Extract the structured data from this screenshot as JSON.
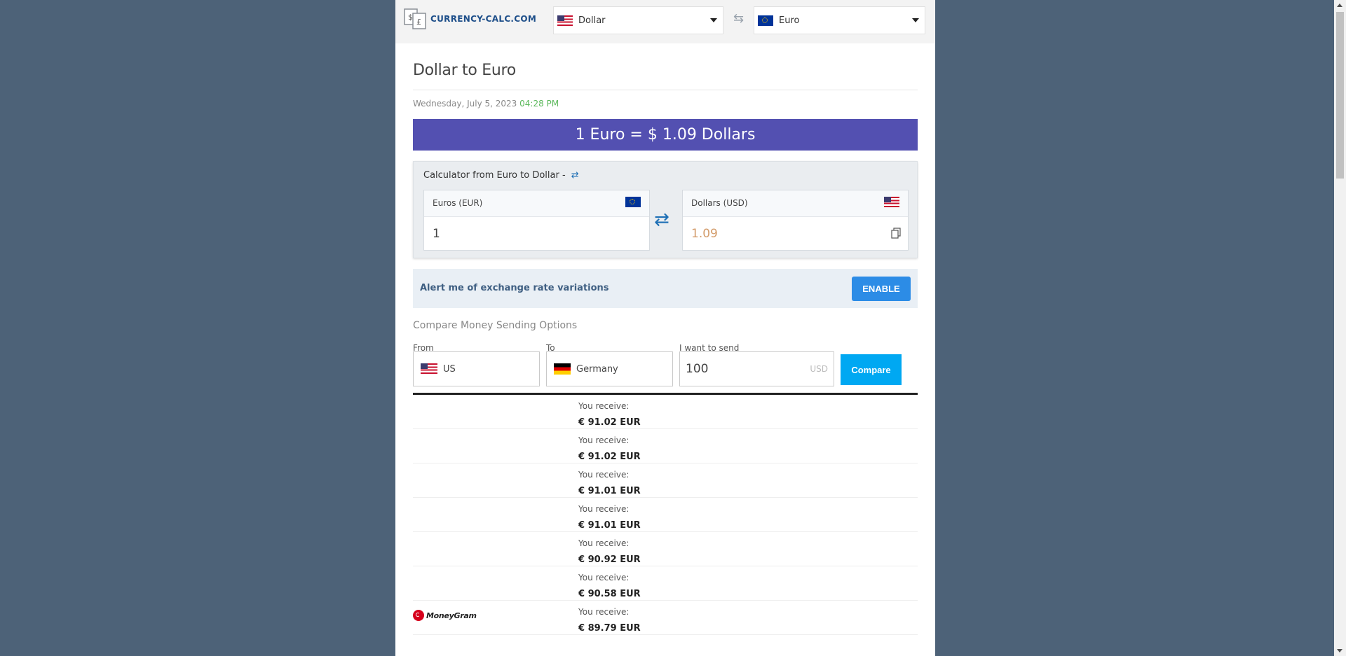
{
  "header": {
    "logo_text": "CURRENCY-CALC.COM",
    "from_currency": "Dollar",
    "to_currency": "Euro"
  },
  "main": {
    "title": "Dollar to Euro",
    "date": "Wednesday, July 5, 2023",
    "time": "04:28 PM",
    "rate_banner": "1 Euro = $ 1.09 Dollars"
  },
  "calculator": {
    "title": "Calculator from Euro to Dollar -",
    "from_label": "Euros (EUR)",
    "from_value": "1",
    "to_label": "Dollars (USD)",
    "to_value": "1.09"
  },
  "alert": {
    "text": "Alert me of exchange rate variations",
    "button": "ENABLE"
  },
  "compare": {
    "title": "Compare Money Sending Options",
    "from_label": "From",
    "from_value": "US",
    "to_label": "To",
    "to_value": "Germany",
    "send_label": "I want to send",
    "send_value": "100",
    "send_unit": "USD",
    "button": "Compare"
  },
  "results": {
    "receive_label": "You receive:",
    "rows": [
      {
        "amount": "€ 91.02 EUR"
      },
      {
        "amount": "€ 91.02 EUR"
      },
      {
        "amount": "€ 91.01 EUR"
      },
      {
        "amount": "€ 91.01 EUR"
      },
      {
        "amount": "€ 90.92 EUR"
      },
      {
        "amount": "€ 90.58 EUR"
      },
      {
        "amount": "€ 89.79 EUR",
        "provider": "MoneyGram"
      }
    ]
  },
  "colors": {
    "background": "#4d6278",
    "banner": "#5350b1",
    "enable_button": "#2c8ce6",
    "compare_button": "#00a8f2",
    "time_green": "#5cb85c"
  }
}
